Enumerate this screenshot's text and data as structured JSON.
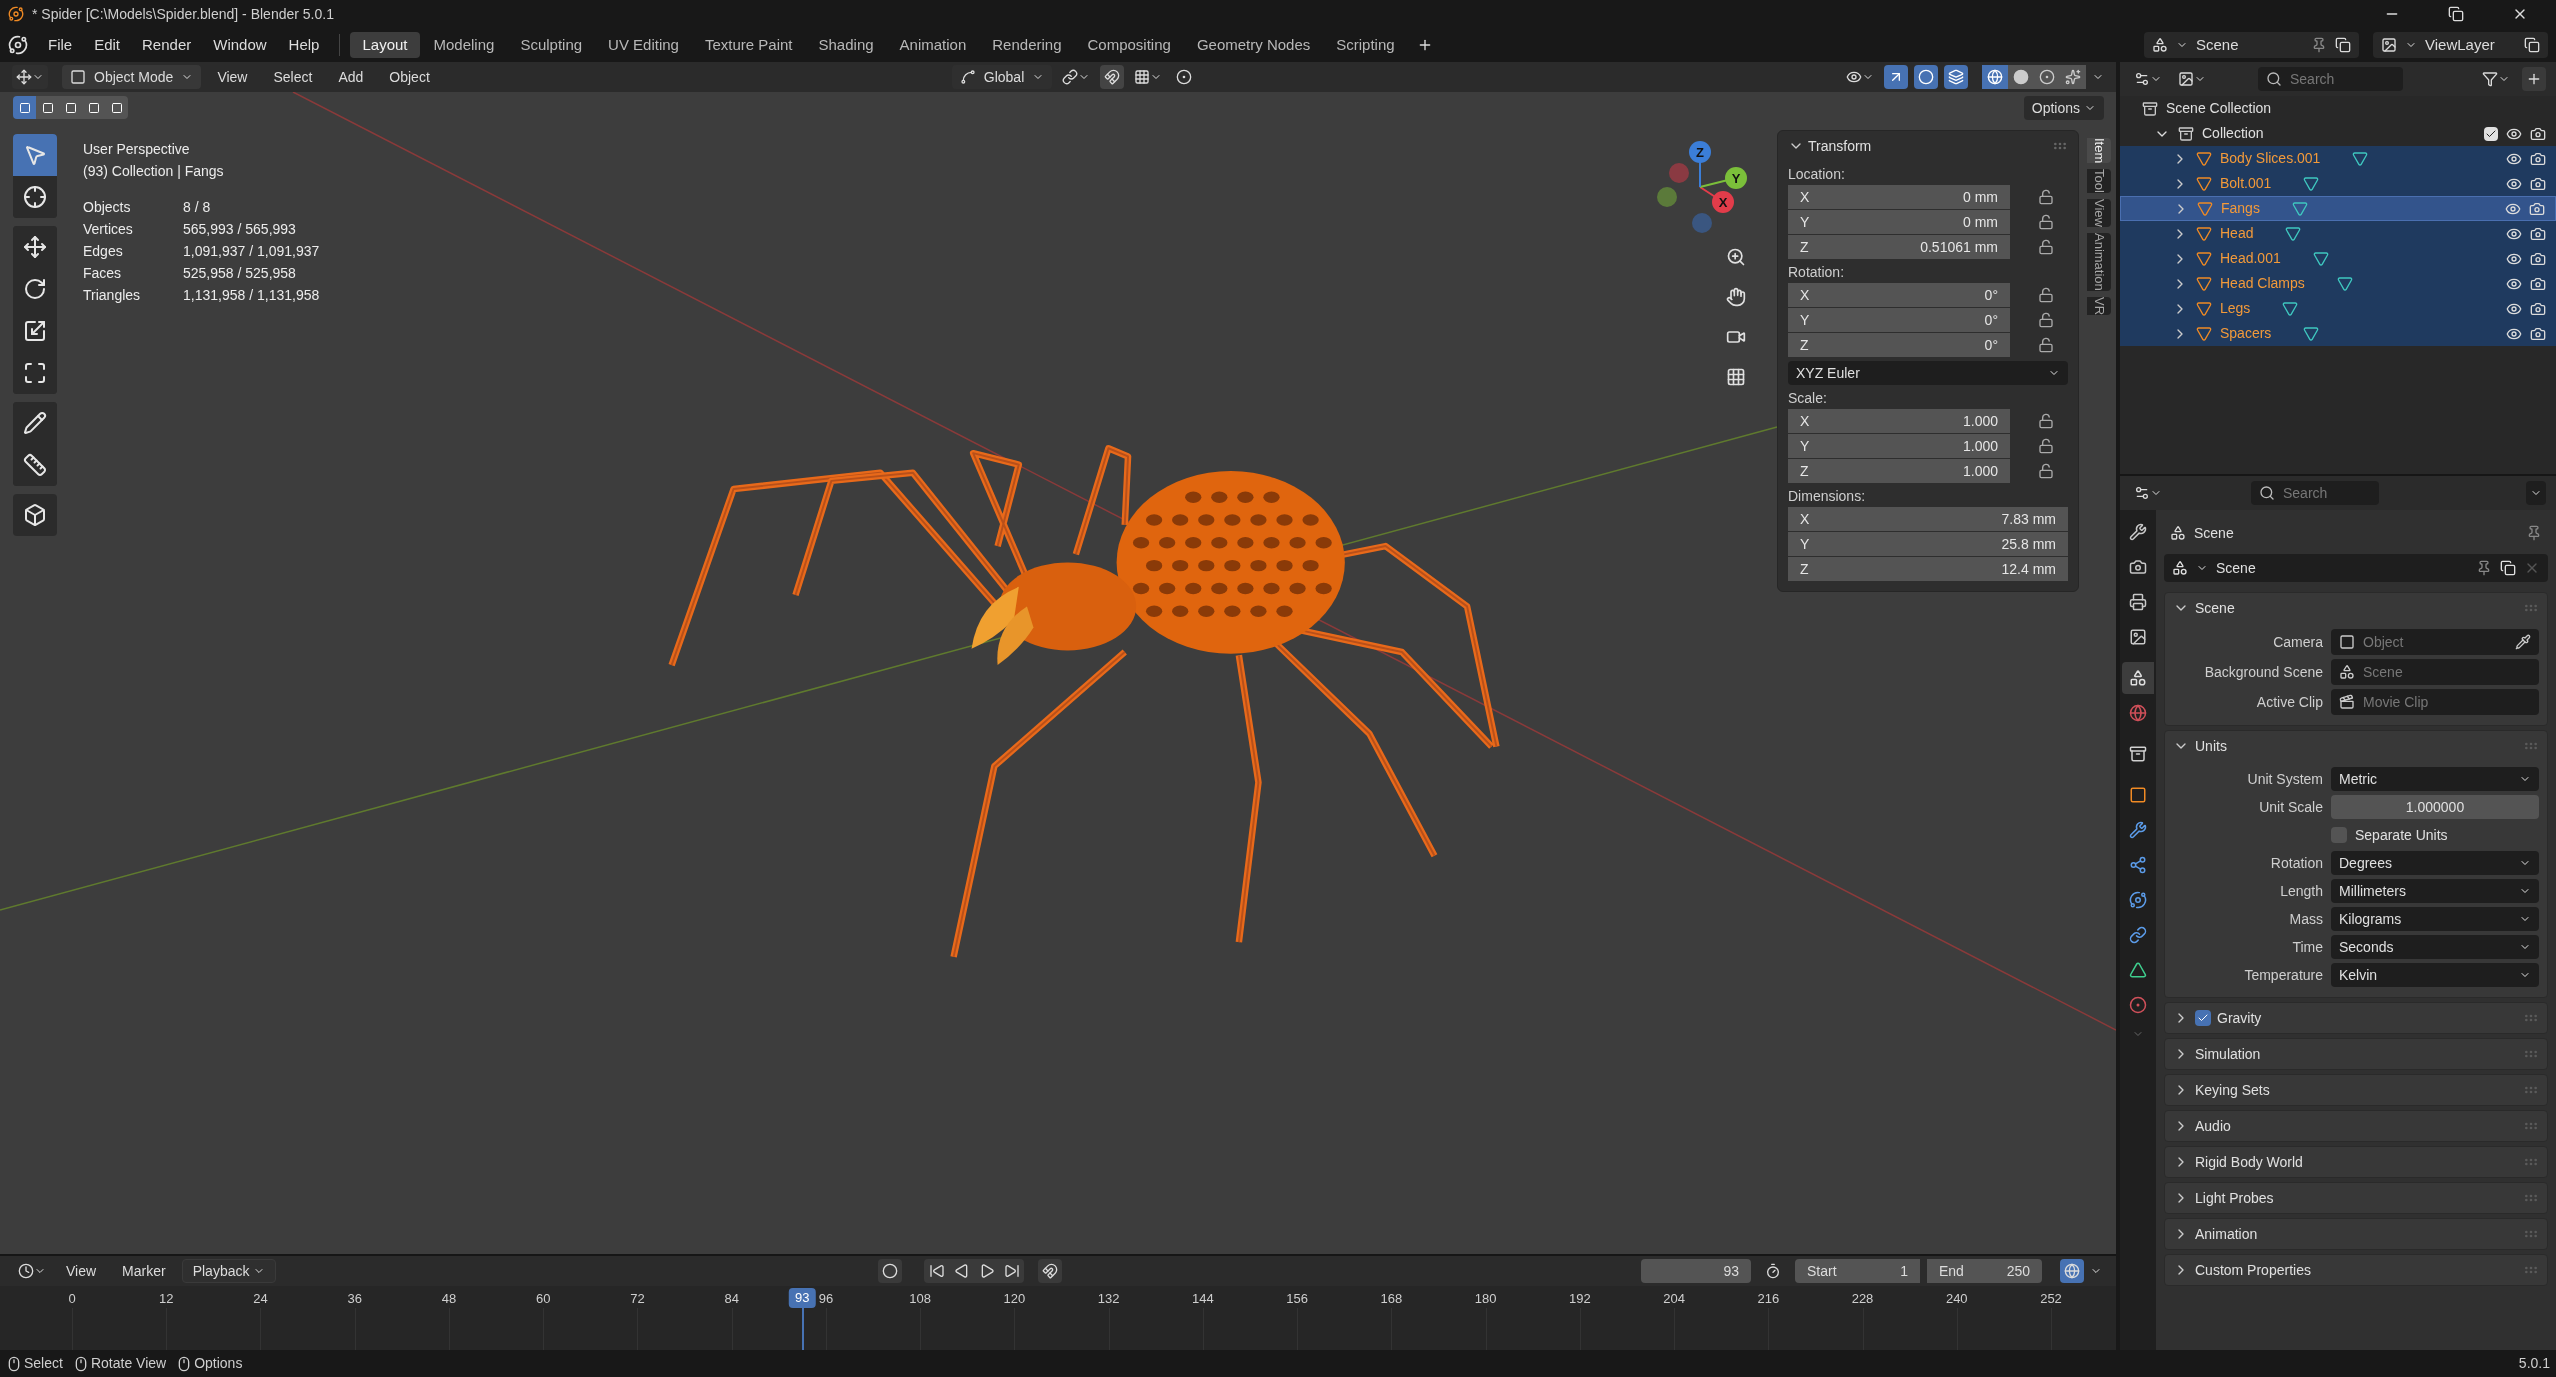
{
  "window": {
    "title": "* Spider [C:\\Models\\Spider.blend] - Blender 5.0.1"
  },
  "menu": [
    "File",
    "Edit",
    "Render",
    "Window",
    "Help"
  ],
  "workspaces": [
    {
      "label": "Layout",
      "selected": true
    },
    {
      "label": "Modeling",
      "selected": false
    },
    {
      "label": "Sculpting",
      "selected": false
    },
    {
      "label": "UV Editing",
      "selected": false
    },
    {
      "label": "Texture Paint",
      "selected": false
    },
    {
      "label": "Shading",
      "selected": false
    },
    {
      "label": "Animation",
      "selected": false
    },
    {
      "label": "Rendering",
      "selected": false
    },
    {
      "label": "Compositing",
      "selected": false
    },
    {
      "label": "Geometry Nodes",
      "selected": false
    },
    {
      "label": "Scripting",
      "selected": false
    }
  ],
  "scene_selector": "Scene",
  "view_layer_selector": "ViewLayer",
  "viewport": {
    "header": {
      "mode": "Object Mode",
      "menus": [
        "View",
        "Select",
        "Add",
        "Object"
      ],
      "orientation": "Global",
      "options": "Options",
      "toggles": [
        {
          "kind": "gizmo",
          "on": true
        },
        {
          "kind": "overlays",
          "on": true
        },
        {
          "kind": "xray",
          "on": true
        }
      ],
      "shading": [
        {
          "kind": "wireframe",
          "selected": true
        },
        {
          "kind": "solid",
          "selected": false
        },
        {
          "kind": "material",
          "selected": false
        },
        {
          "kind": "rendered",
          "selected": false
        }
      ]
    },
    "select_modes": [
      {
        "selected": true
      },
      {
        "selected": false
      },
      {
        "selected": false
      },
      {
        "selected": false
      },
      {
        "selected": false
      }
    ],
    "toolbar": [
      [
        {
          "kind": "select",
          "selected": true
        },
        {
          "kind": "cursor",
          "selected": false
        }
      ],
      [
        {
          "kind": "move",
          "selected": false
        },
        {
          "kind": "rotate",
          "selected": false
        },
        {
          "kind": "scale",
          "selected": false
        },
        {
          "kind": "transform",
          "selected": false
        }
      ],
      [
        {
          "kind": "annotate",
          "selected": false
        },
        {
          "kind": "measure",
          "selected": false
        }
      ],
      [
        {
          "kind": "add_cube",
          "selected": false
        }
      ]
    ],
    "overlay": {
      "view": "User Perspective",
      "context": "(93) Collection | Fangs",
      "stats": [
        {
          "label": "Objects",
          "value": "8 / 8"
        },
        {
          "label": "Vertices",
          "value": "565,993 / 565,993"
        },
        {
          "label": "Edges",
          "value": "1,091,937 / 1,091,937"
        },
        {
          "label": "Faces",
          "value": "525,958 / 525,958"
        },
        {
          "label": "Triangles",
          "value": "1,131,958 / 1,131,958"
        }
      ]
    },
    "gizmo_axes": [
      "X",
      "Y",
      "Z"
    ],
    "sidebar": {
      "tabs": [
        {
          "label": "Item",
          "selected": true
        },
        {
          "label": "Tool",
          "selected": false
        },
        {
          "label": "View",
          "selected": false
        },
        {
          "label": "Animation",
          "selected": false
        },
        {
          "label": "VR",
          "selected": false
        }
      ],
      "panel": {
        "title": "Transform",
        "expanded": true,
        "sections": [
          {
            "label": "Location:",
            "fields": [
              {
                "axis": "X",
                "value": "0 mm",
                "locked": false
              },
              {
                "axis": "Y",
                "value": "0 mm",
                "locked": false
              },
              {
                "axis": "Z",
                "value": "0.51061 mm",
                "locked": false
              }
            ]
          },
          {
            "label": "Rotation:",
            "fields": [
              {
                "axis": "X",
                "value": "0°",
                "locked": false
              },
              {
                "axis": "Y",
                "value": "0°",
                "locked": false
              },
              {
                "axis": "Z",
                "value": "0°",
                "locked": false
              }
            ],
            "mode": "XYZ Euler"
          },
          {
            "label": "Scale:",
            "fields": [
              {
                "axis": "X",
                "value": "1.000",
                "locked": false
              },
              {
                "axis": "Y",
                "value": "1.000",
                "locked": false
              },
              {
                "axis": "Z",
                "value": "1.000",
                "locked": false
              }
            ]
          },
          {
            "label": "Dimensions:",
            "fields": [
              {
                "axis": "X",
                "value": "7.83 mm"
              },
              {
                "axis": "Y",
                "value": "25.8 mm"
              },
              {
                "axis": "Z",
                "value": "12.4 mm"
              }
            ]
          }
        ]
      }
    }
  },
  "timeline": {
    "menus": [
      {
        "label": "View",
        "kind": "menu"
      },
      {
        "label": "Marker",
        "kind": "menu"
      },
      {
        "label": "Playback",
        "kind": "dropdown"
      }
    ],
    "current_frame": "93",
    "start_label": "Start",
    "start": "1",
    "end_label": "End",
    "end": "250",
    "ticks": [
      "0",
      "12",
      "24",
      "36",
      "48",
      "60",
      "72",
      "84",
      "96",
      "108",
      "120",
      "132",
      "144",
      "156",
      "168",
      "180",
      "192",
      "204",
      "216",
      "228",
      "240",
      "252"
    ],
    "playhead": {
      "label": "93",
      "level": 0.369
    }
  },
  "outliner": {
    "search_placeholder": "Search",
    "root": "Scene Collection",
    "collection": {
      "label": "Collection",
      "expanded": true,
      "checked": true,
      "children": [
        {
          "label": "Body Slices.001",
          "selected": true,
          "active": false
        },
        {
          "label": "Bolt.001",
          "selected": true,
          "active": false
        },
        {
          "label": "Fangs",
          "selected": true,
          "active": true
        },
        {
          "label": "Head",
          "selected": true,
          "active": false
        },
        {
          "label": "Head.001",
          "selected": true,
          "active": false
        },
        {
          "label": "Head Clamps",
          "selected": true,
          "active": false
        },
        {
          "label": "Legs",
          "selected": true,
          "active": false
        },
        {
          "label": "Spacers",
          "selected": true,
          "active": false
        }
      ]
    }
  },
  "properties": {
    "search_placeholder": "Search",
    "tabs": [
      {
        "kind": "tool",
        "selected": false
      },
      {
        "kind": "render",
        "selected": false
      },
      {
        "kind": "output",
        "selected": false
      },
      {
        "kind": "view_layer",
        "selected": false
      },
      {
        "kind": "scene",
        "selected": true
      },
      {
        "kind": "world",
        "selected": false
      },
      {
        "kind": "collection",
        "selected": false
      },
      {
        "kind": "object",
        "selected": false
      },
      {
        "kind": "modifiers",
        "selected": false
      },
      {
        "kind": "particles",
        "selected": false
      },
      {
        "kind": "physics",
        "selected": false
      },
      {
        "kind": "constraints",
        "selected": false
      },
      {
        "kind": "data",
        "selected": false
      },
      {
        "kind": "material",
        "selected": false
      }
    ],
    "context": "Scene",
    "datablock": "Scene",
    "panels": [
      {
        "title": "Scene",
        "expanded": true,
        "rows": [
          {
            "kind": "object_picker",
            "label": "Camera",
            "placeholder": "Object"
          },
          {
            "kind": "scene_picker",
            "label": "Background Scene",
            "placeholder": "Scene"
          },
          {
            "kind": "clip_picker",
            "label": "Active Clip",
            "placeholder": "Movie Clip"
          }
        ]
      },
      {
        "title": "Units",
        "expanded": true,
        "rows": [
          {
            "kind": "dropdown",
            "label": "Unit System",
            "value": "Metric"
          },
          {
            "kind": "number",
            "label": "Unit Scale",
            "value": "1.000000"
          },
          {
            "kind": "checkbox",
            "label": "Separate Units",
            "checked": false
          },
          {
            "kind": "dropdown",
            "label": "Rotation",
            "value": "Degrees"
          },
          {
            "kind": "dropdown",
            "label": "Length",
            "value": "Millimeters"
          },
          {
            "kind": "dropdown",
            "label": "Mass",
            "value": "Kilograms"
          },
          {
            "kind": "dropdown",
            "label": "Time",
            "value": "Seconds"
          },
          {
            "kind": "dropdown",
            "label": "Temperature",
            "value": "Kelvin"
          }
        ]
      },
      {
        "title": "Gravity",
        "expanded": false,
        "checked": true
      },
      {
        "title": "Simulation",
        "expanded": false
      },
      {
        "title": "Keying Sets",
        "expanded": false
      },
      {
        "title": "Audio",
        "expanded": false
      },
      {
        "title": "Rigid Body World",
        "expanded": false
      },
      {
        "title": "Light Probes",
        "expanded": false
      },
      {
        "title": "Animation",
        "expanded": false
      },
      {
        "title": "Custom Properties",
        "expanded": false
      }
    ]
  },
  "status_bar": {
    "hints": [
      "Select",
      "Rotate View",
      "Options"
    ],
    "version": "5.0.1"
  }
}
